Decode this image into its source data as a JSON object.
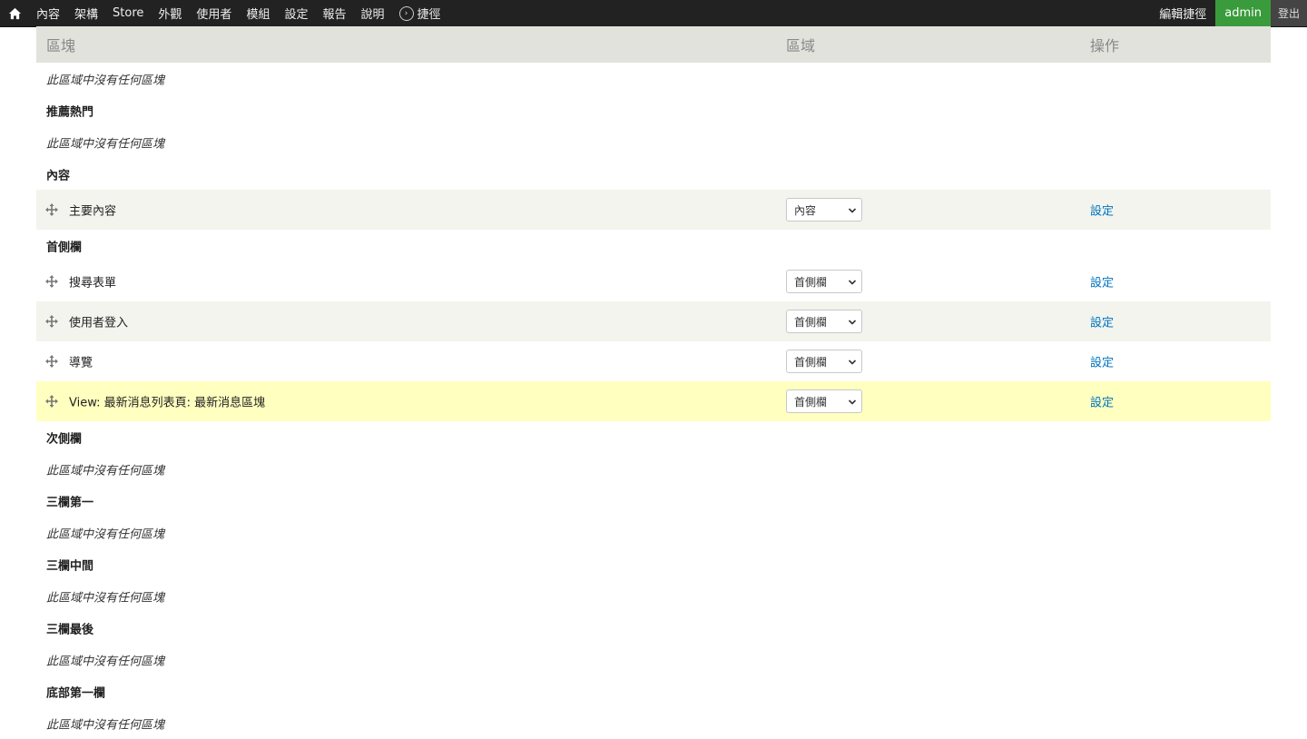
{
  "toolbar": {
    "menu": [
      "內容",
      "架構",
      "Store",
      "外觀",
      "使用者",
      "模組",
      "設定",
      "報告",
      "說明"
    ],
    "shortcuts_label": "捷徑",
    "edit_shortcuts": "編輯捷徑",
    "user": "admin",
    "logout": "登出"
  },
  "table": {
    "headers": {
      "block": "區塊",
      "region": "區域",
      "operations": "操作"
    },
    "empty_text": "此區域中沒有任何區塊",
    "config_label": "設定"
  },
  "rows": [
    {
      "type": "empty",
      "text": "此區域中沒有任何區塊"
    },
    {
      "type": "region",
      "text": "推薦熱門"
    },
    {
      "type": "empty",
      "text": "此區域中沒有任何區塊"
    },
    {
      "type": "region",
      "text": "內容"
    },
    {
      "type": "block",
      "name": "主要內容",
      "region": "內容",
      "op": "設定",
      "style": "even"
    },
    {
      "type": "region",
      "text": "首側欄"
    },
    {
      "type": "block",
      "name": "搜尋表單",
      "region": "首側欄",
      "op": "設定",
      "style": "odd"
    },
    {
      "type": "block",
      "name": "使用者登入",
      "region": "首側欄",
      "op": "設定",
      "style": "even"
    },
    {
      "type": "block",
      "name": "導覽",
      "region": "首側欄",
      "op": "設定",
      "style": "odd"
    },
    {
      "type": "block",
      "name": "View: 最新消息列表頁: 最新消息區塊",
      "region": "首側欄",
      "op": "設定",
      "style": "highlight"
    },
    {
      "type": "region",
      "text": "次側欄"
    },
    {
      "type": "empty",
      "text": "此區域中沒有任何區塊"
    },
    {
      "type": "region",
      "text": "三欄第一"
    },
    {
      "type": "empty",
      "text": "此區域中沒有任何區塊"
    },
    {
      "type": "region",
      "text": "三欄中間"
    },
    {
      "type": "empty",
      "text": "此區域中沒有任何區塊"
    },
    {
      "type": "region",
      "text": "三欄最後"
    },
    {
      "type": "empty",
      "text": "此區域中沒有任何區塊"
    },
    {
      "type": "region",
      "text": "底部第一欄"
    },
    {
      "type": "empty",
      "text": "此區域中沒有任何區塊"
    }
  ]
}
